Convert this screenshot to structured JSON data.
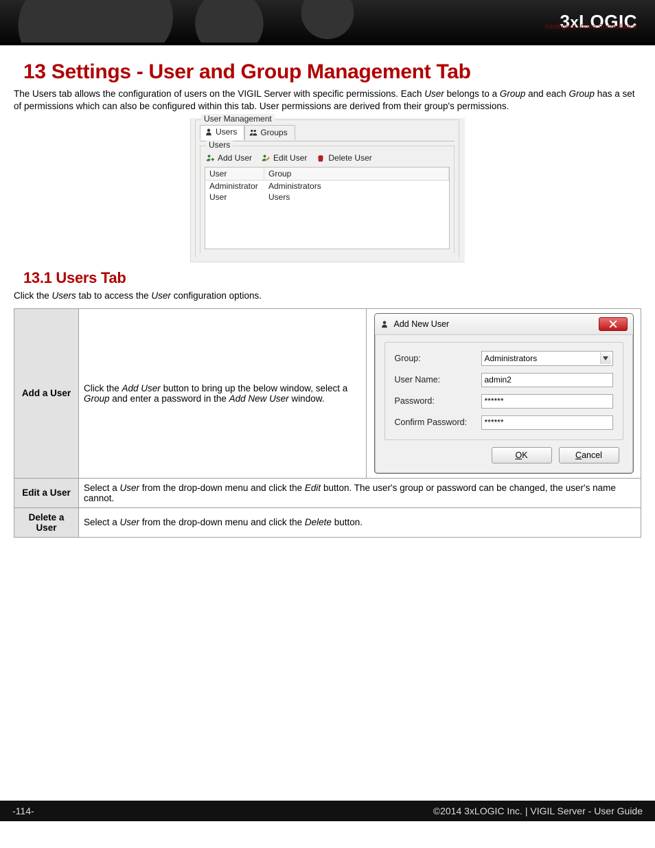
{
  "brand": {
    "name": "3xLOGIC",
    "tagline": "Intelligent Video Surveillance"
  },
  "h1": "13 Settings - User and Group Management Tab",
  "intro": {
    "p1a": "The Users tab allows the configuration of users on the VIGIL Server with specific permissions. Each ",
    "p1b": " belongs to a ",
    "p1c": " and each ",
    "p1d": " has a set of permissions which can also be configured within this tab. User permissions are derived from their group's permissions.",
    "user": "User",
    "group": "Group"
  },
  "um": {
    "group_title": "User Management",
    "tabs": {
      "users": "Users",
      "groups": "Groups"
    },
    "subgroup": "Users",
    "toolbar": {
      "add": "Add User",
      "edit": "Edit User",
      "del": "Delete User"
    },
    "cols": {
      "user": "User",
      "group": "Group"
    },
    "rows": [
      {
        "user": "Administrator",
        "group": "Administrators"
      },
      {
        "user": "User",
        "group": "Users"
      }
    ]
  },
  "h2": "13.1 Users Tab",
  "p2a": "Click the ",
  "p2b": " tab to access the ",
  "p2c": " configuration options.",
  "p2_users": "Users",
  "p2_user": "User",
  "table": {
    "row1": {
      "name": "Add a User",
      "desc_a": "Click the ",
      "desc_b": " button to bring up the below window, select a ",
      "desc_c": " and enter a password in the ",
      "desc_d": " window.",
      "i1": "Add User",
      "i2": "Group",
      "i3": "Add New User"
    },
    "row2": {
      "name": "Edit a User",
      "desc_a": "Select a ",
      "desc_b": " from the drop-down menu and click the ",
      "desc_c": " button.  The user's group or password can be changed, the user's name cannot.",
      "i1": "User",
      "i2": "Edit"
    },
    "row3": {
      "name": "Delete a User",
      "desc_a": "Select a ",
      "desc_b": " from the drop-down menu and click the ",
      "desc_c": " button.",
      "i1": "User",
      "i2": "Delete"
    }
  },
  "dialog": {
    "title": "Add New User",
    "labels": {
      "group": "Group:",
      "username": "User Name:",
      "password": "Password:",
      "confirm": "Confirm Password:"
    },
    "values": {
      "group": "Administrators",
      "username": "admin2",
      "password": "******",
      "confirm": "******"
    },
    "buttons": {
      "ok": "OK",
      "cancel": "Cancel",
      "ok_u": "O",
      "ok_rest": "K",
      "cancel_u": "C",
      "cancel_rest": "ancel"
    }
  },
  "footer": {
    "page": "-114-",
    "right": "©2014 3xLOGIC Inc. | VIGIL Server - User Guide"
  }
}
